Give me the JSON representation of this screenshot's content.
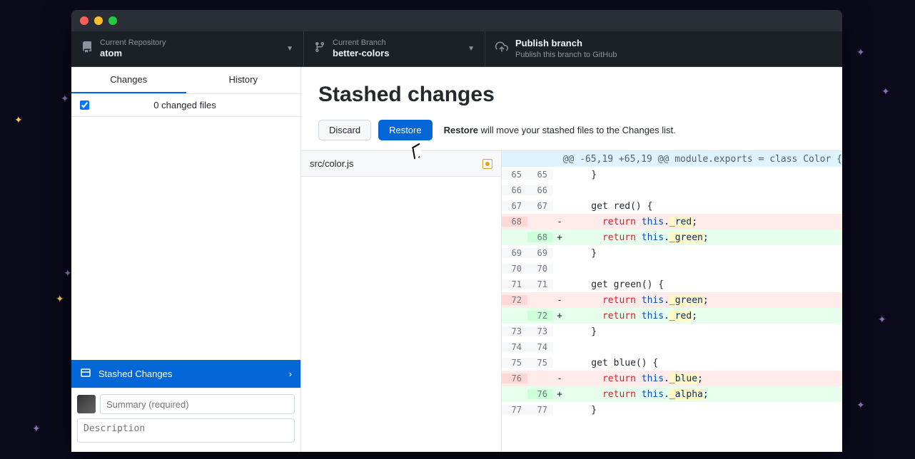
{
  "toolbar": {
    "repo": {
      "label": "Current Repository",
      "value": "atom"
    },
    "branch": {
      "label": "Current Branch",
      "value": "better-colors"
    },
    "publish": {
      "label": "Publish branch",
      "sub": "Publish this branch to GitHub"
    }
  },
  "sidebar": {
    "tabs": {
      "changes": "Changes",
      "history": "History"
    },
    "files_header": "0 changed files",
    "stashed_label": "Stashed Changes",
    "summary_placeholder": "Summary (required)",
    "description_placeholder": "Description"
  },
  "main": {
    "title": "Stashed changes",
    "discard": "Discard",
    "restore": "Restore",
    "help_strong": "Restore",
    "help_rest": " will move your stashed files to the Changes list."
  },
  "diff": {
    "file": "src/color.js",
    "hunk": "@@ -65,19 +65,19 @@ module.exports = class Color {",
    "rows": [
      {
        "a": "65",
        "b": "65",
        "t": "ctx",
        "m": " ",
        "pre": "    }",
        "prop": "",
        "post": ""
      },
      {
        "a": "66",
        "b": "66",
        "t": "ctx",
        "m": " ",
        "pre": "",
        "prop": "",
        "post": ""
      },
      {
        "a": "67",
        "b": "67",
        "t": "ctx",
        "m": " ",
        "pre": "    get red() {",
        "prop": "",
        "post": ""
      },
      {
        "a": "68",
        "b": "",
        "t": "del",
        "m": "-",
        "pre": "      return this.",
        "prop": "_red",
        "post": ";"
      },
      {
        "a": "",
        "b": "68",
        "t": "add",
        "m": "+",
        "pre": "      return this.",
        "prop": "_green",
        "post": ";"
      },
      {
        "a": "69",
        "b": "69",
        "t": "ctx",
        "m": " ",
        "pre": "    }",
        "prop": "",
        "post": ""
      },
      {
        "a": "70",
        "b": "70",
        "t": "ctx",
        "m": " ",
        "pre": "",
        "prop": "",
        "post": ""
      },
      {
        "a": "71",
        "b": "71",
        "t": "ctx",
        "m": " ",
        "pre": "    get green() {",
        "prop": "",
        "post": ""
      },
      {
        "a": "72",
        "b": "",
        "t": "del",
        "m": "-",
        "pre": "      return this.",
        "prop": "_green",
        "post": ";"
      },
      {
        "a": "",
        "b": "72",
        "t": "add",
        "m": "+",
        "pre": "      return this.",
        "prop": "_red",
        "post": ";"
      },
      {
        "a": "73",
        "b": "73",
        "t": "ctx",
        "m": " ",
        "pre": "    }",
        "prop": "",
        "post": ""
      },
      {
        "a": "74",
        "b": "74",
        "t": "ctx",
        "m": " ",
        "pre": "",
        "prop": "",
        "post": ""
      },
      {
        "a": "75",
        "b": "75",
        "t": "ctx",
        "m": " ",
        "pre": "    get blue() {",
        "prop": "",
        "post": ""
      },
      {
        "a": "76",
        "b": "",
        "t": "del",
        "m": "-",
        "pre": "      return this.",
        "prop": "_blue",
        "post": ";"
      },
      {
        "a": "",
        "b": "76",
        "t": "add",
        "m": "+",
        "pre": "      return this.",
        "prop": "_alpha",
        "post": ";"
      },
      {
        "a": "77",
        "b": "77",
        "t": "ctx",
        "m": " ",
        "pre": "    }",
        "prop": "",
        "post": ""
      }
    ]
  }
}
